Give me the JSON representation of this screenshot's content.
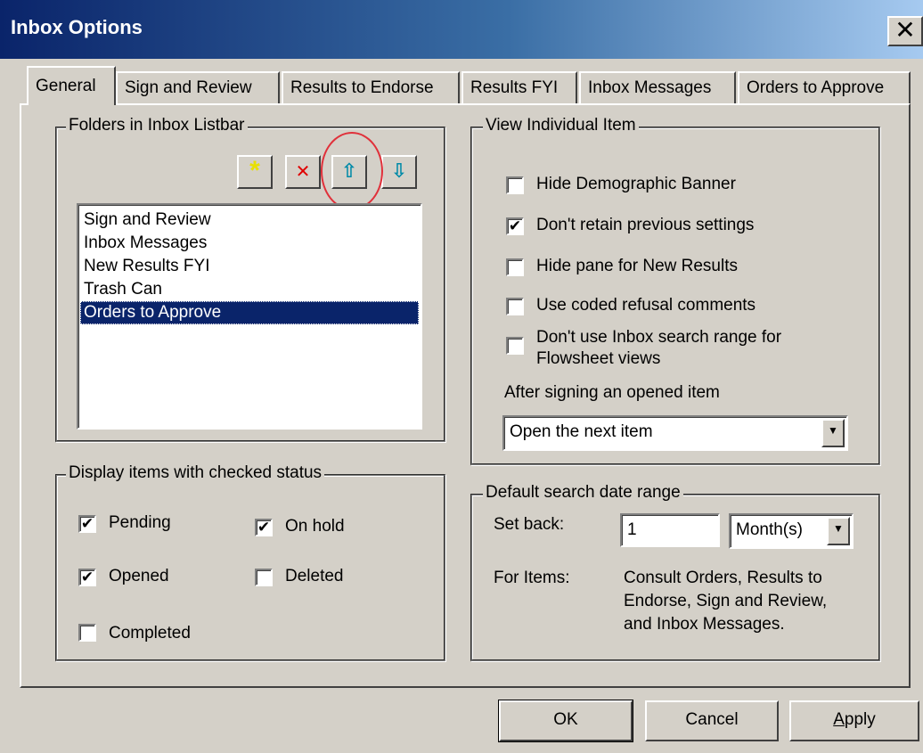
{
  "window": {
    "title": "Inbox Options",
    "close_label": "✕"
  },
  "tabs": [
    {
      "label": "General",
      "active": true
    },
    {
      "label": "Sign and Review"
    },
    {
      "label": "Results to Endorse"
    },
    {
      "label": "Results FYI"
    },
    {
      "label": "Inbox Messages"
    },
    {
      "label": "Orders to Approve"
    }
  ],
  "folders": {
    "title": "Folders in Inbox Listbar",
    "toolbar": {
      "new_icon": "*",
      "delete_icon": "✕",
      "up_icon": "⇧",
      "down_icon": "⇩",
      "colors": {
        "new": "#e8e000",
        "delete": "#e00000",
        "arrows": "#00a0c0"
      }
    },
    "items": [
      "Sign and Review",
      "Inbox Messages",
      "New Results FYI",
      "Trash Can",
      "Orders to Approve"
    ],
    "selected_index": 4
  },
  "status": {
    "title": "Display items with checked status",
    "pending": {
      "label": "Pending",
      "checked": true,
      "mark": "✔"
    },
    "on_hold": {
      "label": "On hold",
      "checked": true,
      "mark": "✔"
    },
    "opened": {
      "label": "Opened",
      "checked": true,
      "mark": "✔"
    },
    "deleted": {
      "label": "Deleted",
      "checked": false,
      "mark": ""
    },
    "completed": {
      "label": "Completed",
      "checked": false,
      "mark": ""
    }
  },
  "view": {
    "title": "View Individual Item",
    "hide_banner": {
      "label": "Hide Demographic Banner",
      "checked": false,
      "mark": ""
    },
    "dont_retain": {
      "label": "Don't retain previous settings",
      "checked": true,
      "mark": "✔"
    },
    "hide_pane": {
      "label": "Hide pane for New Results",
      "checked": false,
      "mark": ""
    },
    "coded_refusal": {
      "label": "Use coded refusal comments",
      "checked": false,
      "mark": ""
    },
    "search_range": {
      "label_line1": "Don't use Inbox search range for",
      "label_line2": "Flowsheet views",
      "checked": false,
      "mark": ""
    },
    "after_signing_label": "After signing an opened item",
    "after_signing_value": "Open the next item",
    "dropdown_arrow": "▼"
  },
  "search": {
    "title": "Default search date range",
    "set_back_label": "Set back:",
    "set_back_value": "1",
    "unit_value": "Month(s)",
    "for_items_label": "For Items:",
    "for_items_line1": "Consult Orders, Results to",
    "for_items_line2": "Endorse, Sign and Review,",
    "for_items_line3": "and Inbox Messages."
  },
  "buttons": {
    "ok": "OK",
    "cancel": "Cancel",
    "apply": "Apply"
  }
}
